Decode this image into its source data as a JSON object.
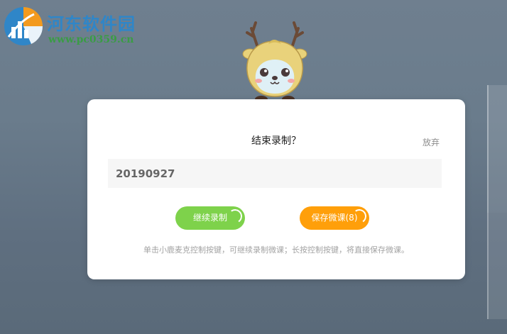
{
  "watermark": {
    "title": "河东软件园",
    "url": "www.pc0359.cn"
  },
  "dialog": {
    "title": "结束录制？",
    "discard_label": "放弃",
    "name_value": "20190927",
    "continue_label": "继续录制",
    "save_label": "保存微课(8)",
    "hint": "单击小鹿麦克控制按键，可继续录制微课；长按控制按键，将直接保存微课。"
  },
  "colors": {
    "continue_button": "#7ed24b",
    "save_button": "#ff9f0a",
    "watermark_title": "#2f86c8",
    "watermark_url": "#3a9c45"
  },
  "icons": {
    "watermark_logo": "pie-chart-logo",
    "mascot": "deer-mascot"
  }
}
